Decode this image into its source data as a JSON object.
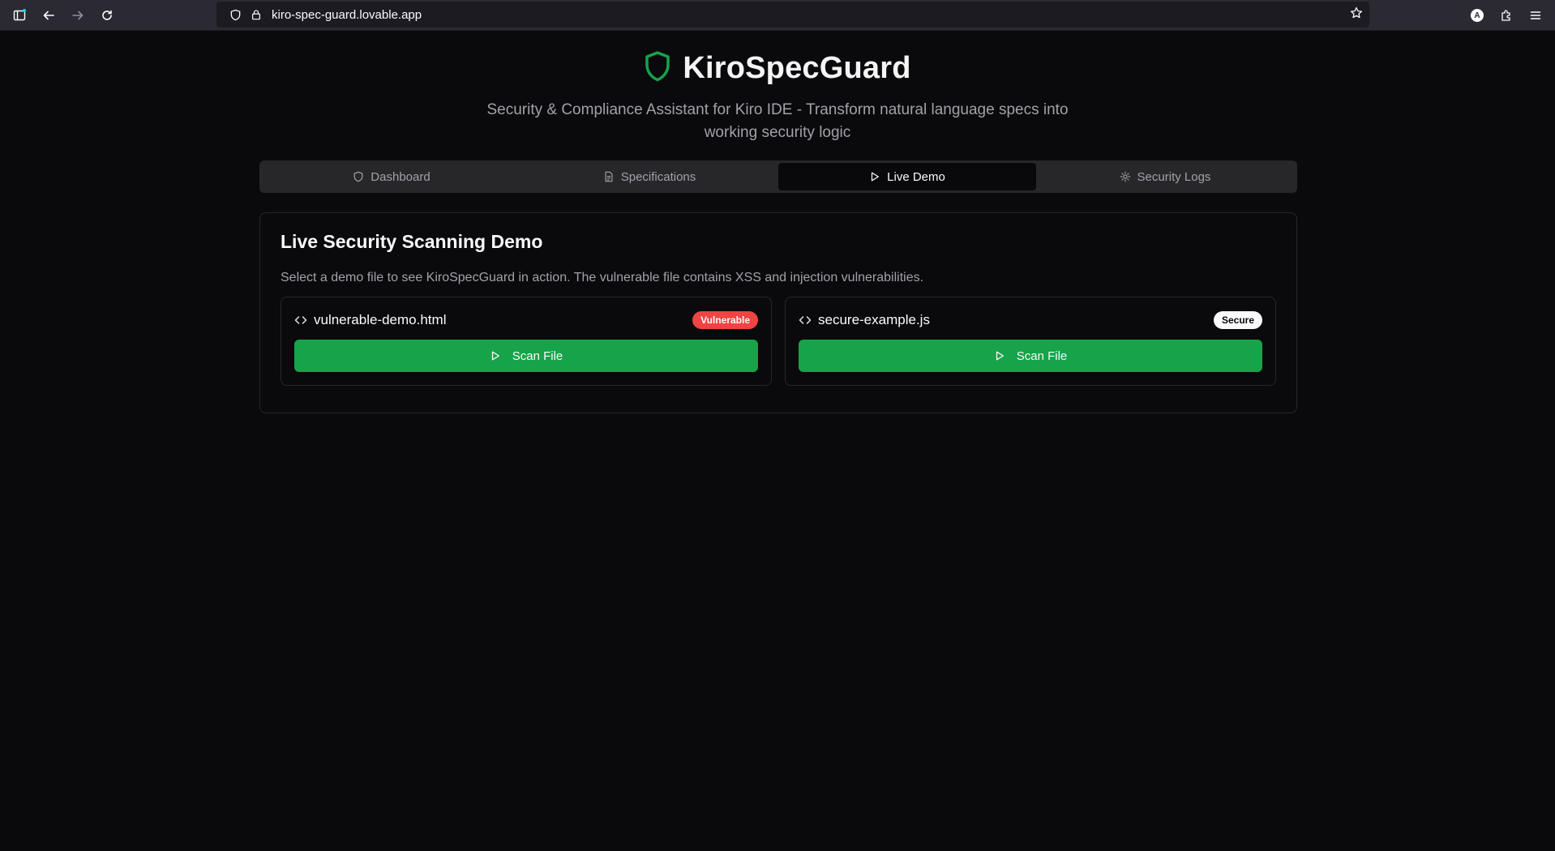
{
  "browser": {
    "url": "kiro-spec-guard.lovable.app",
    "account_initial": "A"
  },
  "header": {
    "title": "KiroSpecGuard",
    "subtitle": "Security & Compliance Assistant for Kiro IDE - Transform natural language specs into working security logic",
    "brand_color": "#16a34a"
  },
  "tabs": [
    {
      "label": "Dashboard",
      "icon": "shield-icon",
      "active": false
    },
    {
      "label": "Specifications",
      "icon": "file-text-icon",
      "active": false
    },
    {
      "label": "Live Demo",
      "icon": "play-icon",
      "active": true
    },
    {
      "label": "Security Logs",
      "icon": "gear-icon",
      "active": false
    }
  ],
  "demo": {
    "title": "Live Security Scanning Demo",
    "description": "Select a demo file to see KiroSpecGuard in action. The vulnerable file contains XSS and injection vulnerabilities.",
    "files": [
      {
        "name": "vulnerable-demo.html",
        "badge": "Vulnerable",
        "badge_color": "#ef4444",
        "button": "Scan File"
      },
      {
        "name": "secure-example.js",
        "badge": "Secure",
        "badge_color": "#fafafa",
        "button": "Scan File"
      }
    ]
  }
}
